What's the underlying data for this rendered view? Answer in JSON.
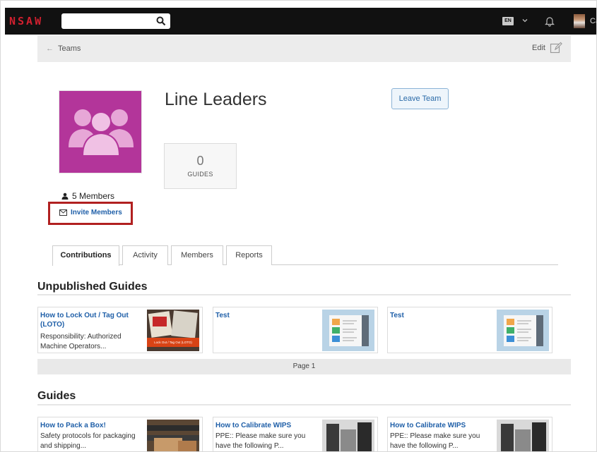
{
  "nav": {
    "logo": "NSAW",
    "search_placeholder": "",
    "language": "EN",
    "user_truncated": "Ca"
  },
  "breadcrumb": {
    "back_label": "Teams",
    "edit_label": "Edit"
  },
  "team": {
    "name": "Line Leaders",
    "leave_label": "Leave Team",
    "guides_count": "0",
    "guides_label": "GUIDES",
    "members_count": "5 Members",
    "invite_label": "Invite Members",
    "image_color": "#b3359a"
  },
  "tabs": [
    "Contributions",
    "Activity",
    "Members",
    "Reports"
  ],
  "active_tab": "Contributions",
  "unpublished": {
    "heading": "Unpublished Guides",
    "cards": [
      {
        "title": "How to Lock Out / Tag Out (LOTO)",
        "desc": "Responsibility: Authorized Machine Operators...",
        "thumb_caption": "Lock Out / Tag Out (LOTO)"
      },
      {
        "title": "Test",
        "desc": ""
      },
      {
        "title": "Test",
        "desc": ""
      }
    ],
    "page_label": "Page 1"
  },
  "guides": {
    "heading": "Guides",
    "cards": [
      {
        "title": "How to Pack a Box!",
        "desc": "Safety protocols for packaging and shipping..."
      },
      {
        "title": "How to Calibrate WIPS",
        "desc": "PPE:: Please make sure you have the following P..."
      },
      {
        "title": "How to Calibrate WIPS",
        "desc": "PPE:: Please make sure you have the following P..."
      }
    ]
  },
  "colors": {
    "accent": "#1f5fa8",
    "highlight": "#b12020",
    "topbar": "#111111"
  }
}
